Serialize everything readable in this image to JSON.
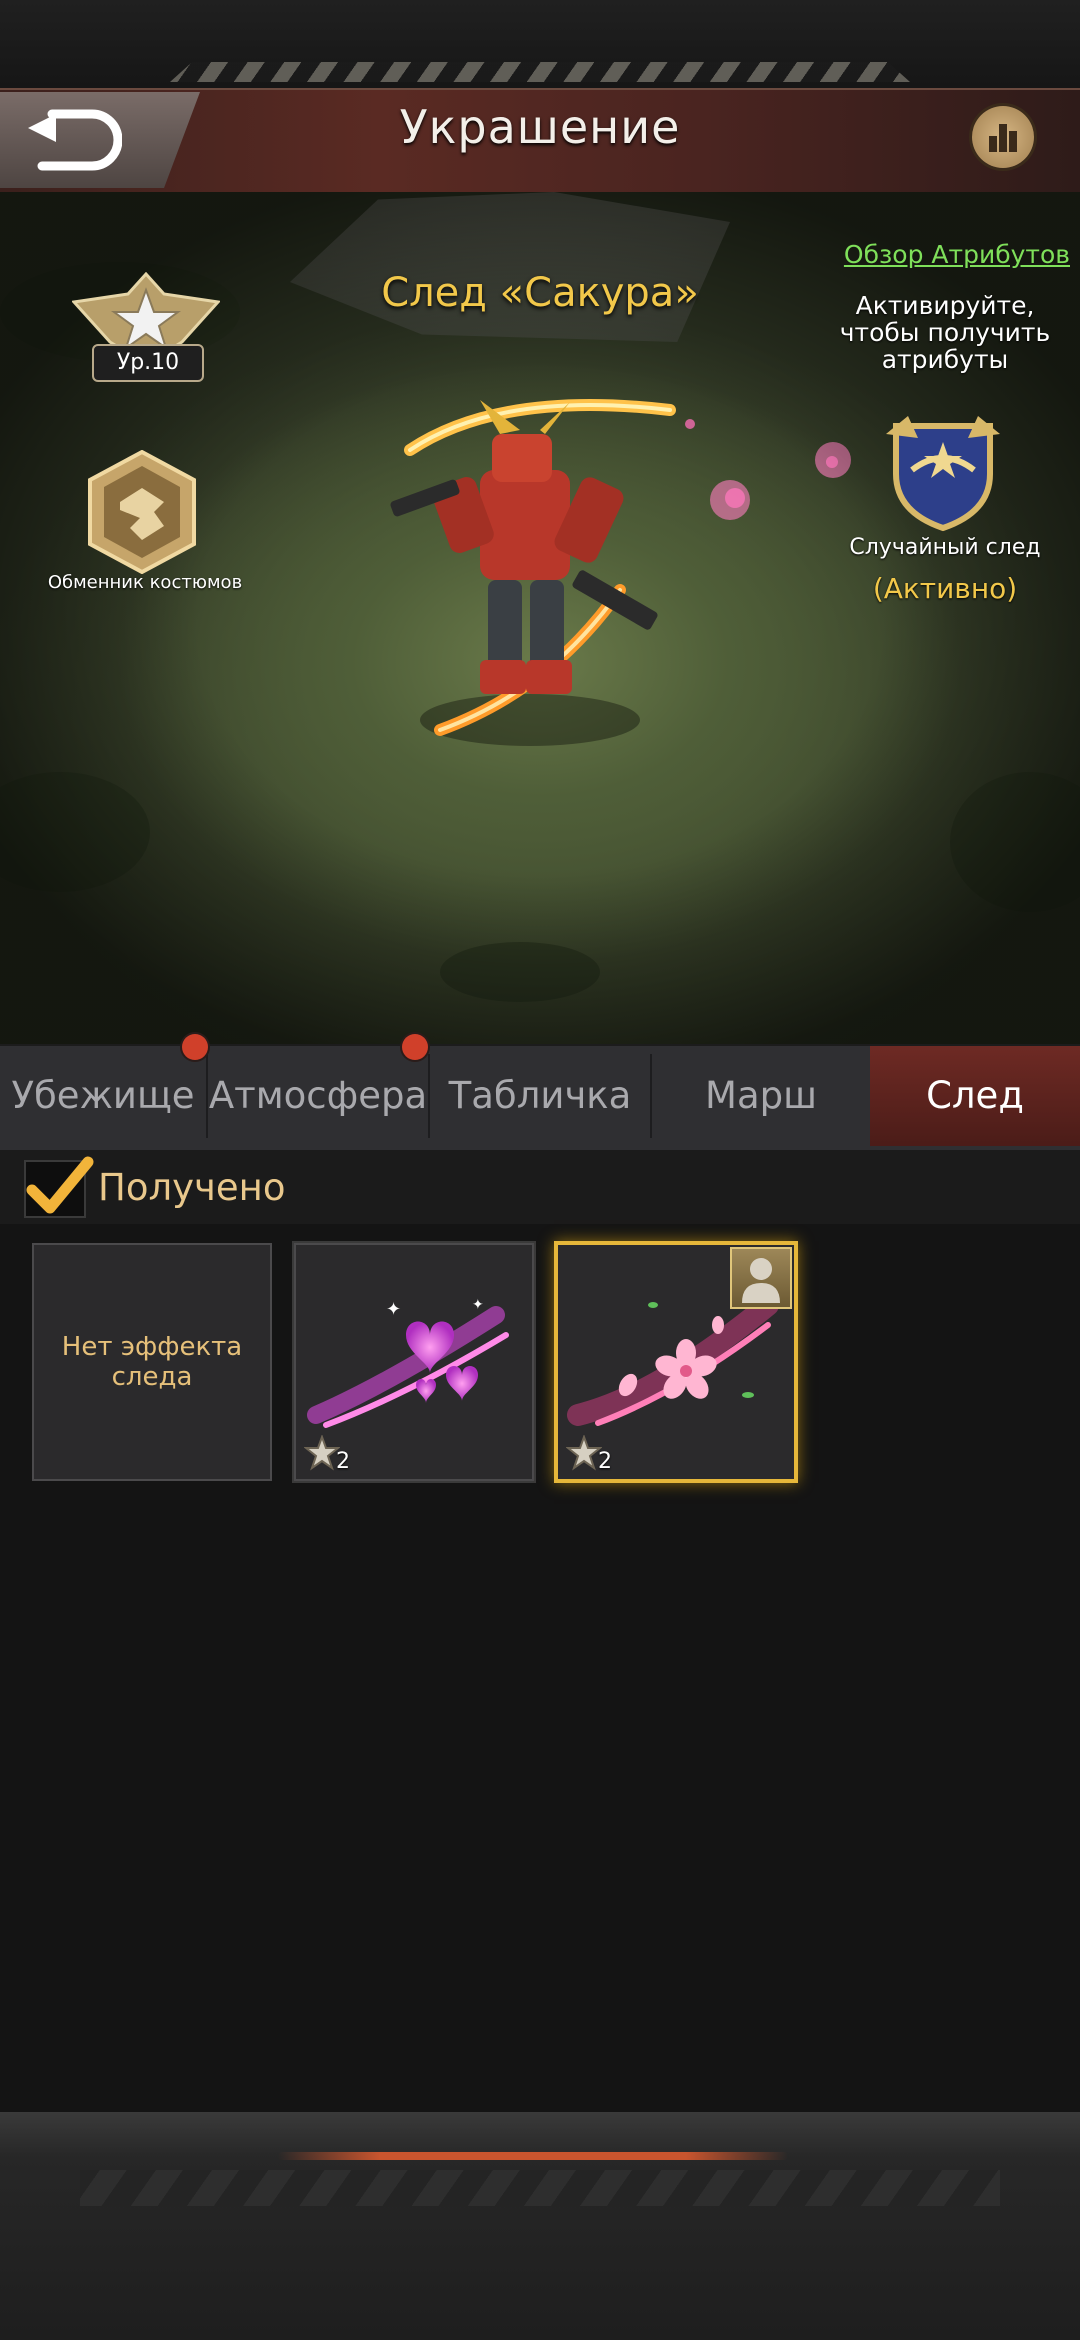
{
  "header": {
    "title": "Украшение",
    "back_icon": "back-arrow-icon",
    "stats_icon": "bar-chart-icon"
  },
  "scene": {
    "trail_name": "След «Сакура»",
    "level_label": "Ур.10",
    "exchanger_label": "Обменник костюмов",
    "overview_link": "Обзор Атрибутов",
    "activate_line1": "Активируйте,",
    "activate_line2": "чтобы получить",
    "activate_line3": "атрибуты",
    "random_trail_label": "Случайный след",
    "random_trail_status": "(Активно)"
  },
  "tabs": [
    {
      "label": "Убежище",
      "has_dot": false
    },
    {
      "label": "Атмосфера",
      "has_dot": true
    },
    {
      "label": "Табличка",
      "has_dot": true
    },
    {
      "label": "Марш",
      "has_dot": false
    },
    {
      "label": "След",
      "has_dot": false,
      "active": true
    }
  ],
  "filter": {
    "label": "Получено",
    "checked": true
  },
  "items": [
    {
      "label": "Нет эффекта следа",
      "stars": null
    },
    {
      "stars": "2",
      "effect": "hearts-trail"
    },
    {
      "stars": "2",
      "effect": "sakura-trail",
      "selected": true,
      "owner_badge": true
    }
  ],
  "colors": {
    "accent_gold": "#f2c84a",
    "link_green": "#7fe05a",
    "active_tab": "#6e2a24",
    "notification_dot": "#d0402a",
    "selected_border": "#e6b73a"
  }
}
